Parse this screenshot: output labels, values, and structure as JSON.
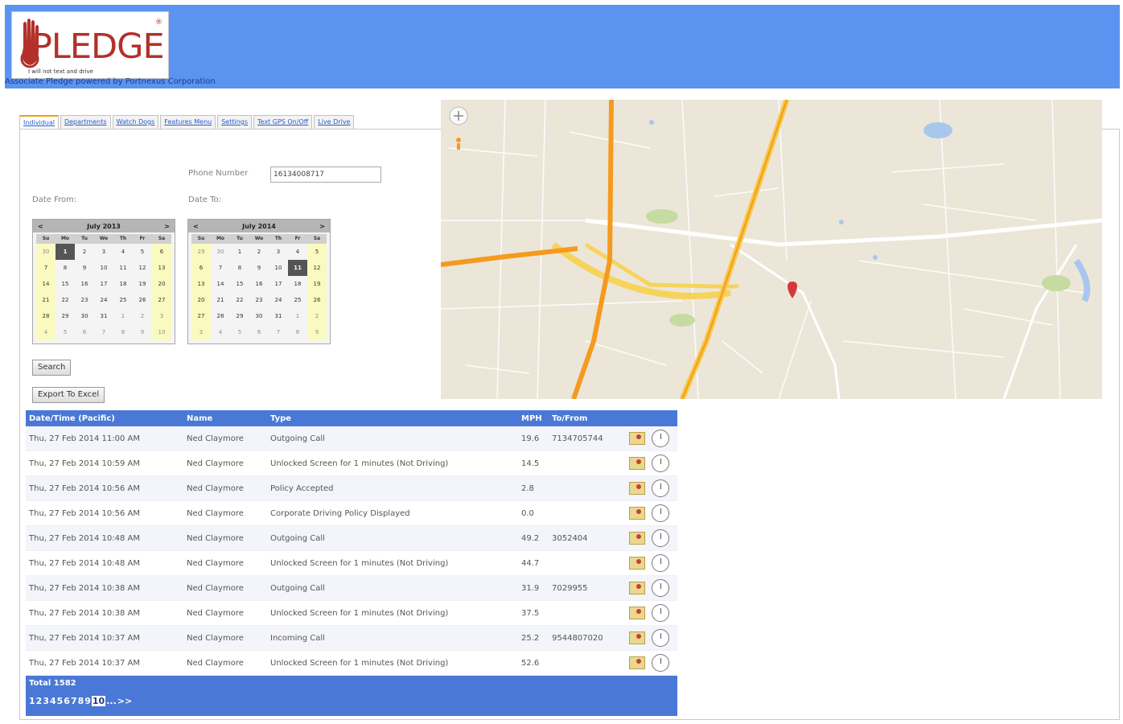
{
  "header": {
    "logo_text": "PLEDGE",
    "logo_tagline": "I will not text and drive",
    "subtitle": "Associate Pledge powered by Portnexus Corporation",
    "brand_color": "#5a93f0"
  },
  "tabs": [
    {
      "label": "Individual",
      "active": true
    },
    {
      "label": "Departments",
      "active": false
    },
    {
      "label": "Watch Dogs",
      "active": false
    },
    {
      "label": "Features Menu",
      "active": false
    },
    {
      "label": "Settings",
      "active": false
    },
    {
      "label": "Text GPS On/Off",
      "active": false
    },
    {
      "label": "Live Drive",
      "active": false
    }
  ],
  "form": {
    "phone_label": "Phone Number",
    "phone_value": "16134008717",
    "date_from_label": "Date From:",
    "date_to_label": "Date To:",
    "search_label": "Search",
    "export_label": "Export To Excel"
  },
  "calendars": {
    "from": {
      "title": "July 2013",
      "prev": "<",
      "next": ">",
      "dow": [
        "Su",
        "Mo",
        "Tu",
        "We",
        "Th",
        "Fr",
        "Sa"
      ],
      "days": [
        "30",
        "1",
        "2",
        "3",
        "4",
        "5",
        "6",
        "7",
        "8",
        "9",
        "10",
        "11",
        "12",
        "13",
        "14",
        "15",
        "16",
        "17",
        "18",
        "19",
        "20",
        "21",
        "22",
        "23",
        "24",
        "25",
        "26",
        "27",
        "28",
        "29",
        "30",
        "31",
        "1",
        "2",
        "3",
        "4",
        "5",
        "6",
        "7",
        "8",
        "9",
        "10"
      ]
    },
    "to": {
      "title": "July 2014",
      "prev": "<",
      "next": ">",
      "dow": [
        "Su",
        "Mo",
        "Tu",
        "We",
        "Th",
        "Fr",
        "Sa"
      ],
      "days": [
        "29",
        "30",
        "1",
        "2",
        "3",
        "4",
        "5",
        "6",
        "7",
        "8",
        "9",
        "10",
        "11",
        "12",
        "13",
        "14",
        "15",
        "16",
        "17",
        "18",
        "19",
        "20",
        "21",
        "22",
        "23",
        "24",
        "25",
        "26",
        "27",
        "28",
        "29",
        "30",
        "31",
        "1",
        "2",
        "3",
        "4",
        "5",
        "6",
        "7",
        "8",
        "9"
      ]
    }
  },
  "table": {
    "headers": [
      "Date/Time (Pacific)",
      "Name",
      "Type",
      "MPH",
      "To/From"
    ],
    "rows": [
      {
        "date": "Thu, 27 Feb 2014 11:00 AM",
        "name": "Ned Claymore",
        "type": "Outgoing Call",
        "mph": "19.6",
        "to": "7134705744"
      },
      {
        "date": "Thu, 27 Feb 2014 10:59 AM",
        "name": "Ned Claymore",
        "type": "Unlocked Screen for 1 minutes (Not Driving)",
        "mph": "14.5",
        "to": ""
      },
      {
        "date": "Thu, 27 Feb 2014 10:56 AM",
        "name": "Ned Claymore",
        "type": "Policy Accepted",
        "mph": "2.8",
        "to": ""
      },
      {
        "date": "Thu, 27 Feb 2014 10:56 AM",
        "name": "Ned Claymore",
        "type": "Corporate Driving Policy Displayed",
        "mph": "0.0",
        "to": ""
      },
      {
        "date": "Thu, 27 Feb 2014 10:48 AM",
        "name": "Ned Claymore",
        "type": "Outgoing Call",
        "mph": "49.2",
        "to": "3052404"
      },
      {
        "date": "Thu, 27 Feb 2014 10:48 AM",
        "name": "Ned Claymore",
        "type": "Unlocked Screen for 1 minutes (Not Driving)",
        "mph": "44.7",
        "to": ""
      },
      {
        "date": "Thu, 27 Feb 2014 10:38 AM",
        "name": "Ned Claymore",
        "type": "Outgoing Call",
        "mph": "31.9",
        "to": "7029955"
      },
      {
        "date": "Thu, 27 Feb 2014 10:38 AM",
        "name": "Ned Claymore",
        "type": "Unlocked Screen for 1 minutes (Not Driving)",
        "mph": "37.5",
        "to": ""
      },
      {
        "date": "Thu, 27 Feb 2014 10:37 AM",
        "name": "Ned Claymore",
        "type": "Incoming Call",
        "mph": "25.2",
        "to": "9544807020"
      },
      {
        "date": "Thu, 27 Feb 2014 10:37 AM",
        "name": "Ned Claymore",
        "type": "Unlocked Screen for 1 minutes (Not Driving)",
        "mph": "52.6",
        "to": ""
      }
    ],
    "total_label": "Total 1582",
    "pages": [
      "1",
      "2",
      "3",
      "4",
      "5",
      "6",
      "7",
      "8",
      "9",
      "10",
      "...",
      ">>"
    ],
    "current_page": "10",
    "header_color": "#4a78d6"
  }
}
